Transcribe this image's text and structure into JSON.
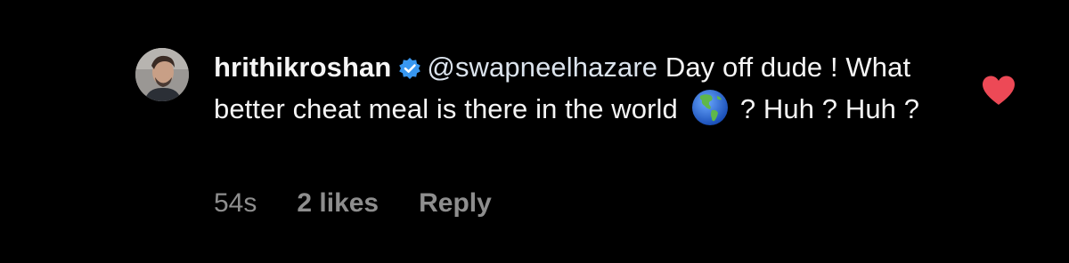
{
  "comment": {
    "username": "hrithikroshan",
    "verified": true,
    "avatar_icon": "profile-photo",
    "mention": "@swapneelhazare",
    "text_before_emoji": "Day off dude ! What better cheat meal is there in the world",
    "emoji": "globe-americas-icon",
    "text_after_emoji": "? Huh ? Huh ?",
    "time": "54s",
    "likes": "2 likes",
    "reply_label": "Reply",
    "liked": true
  },
  "colors": {
    "background": "#000000",
    "text": "#f5f5f5",
    "meta": "#8e8e8e",
    "verified_badge": "#3897f0",
    "heart": "#ed4956"
  }
}
